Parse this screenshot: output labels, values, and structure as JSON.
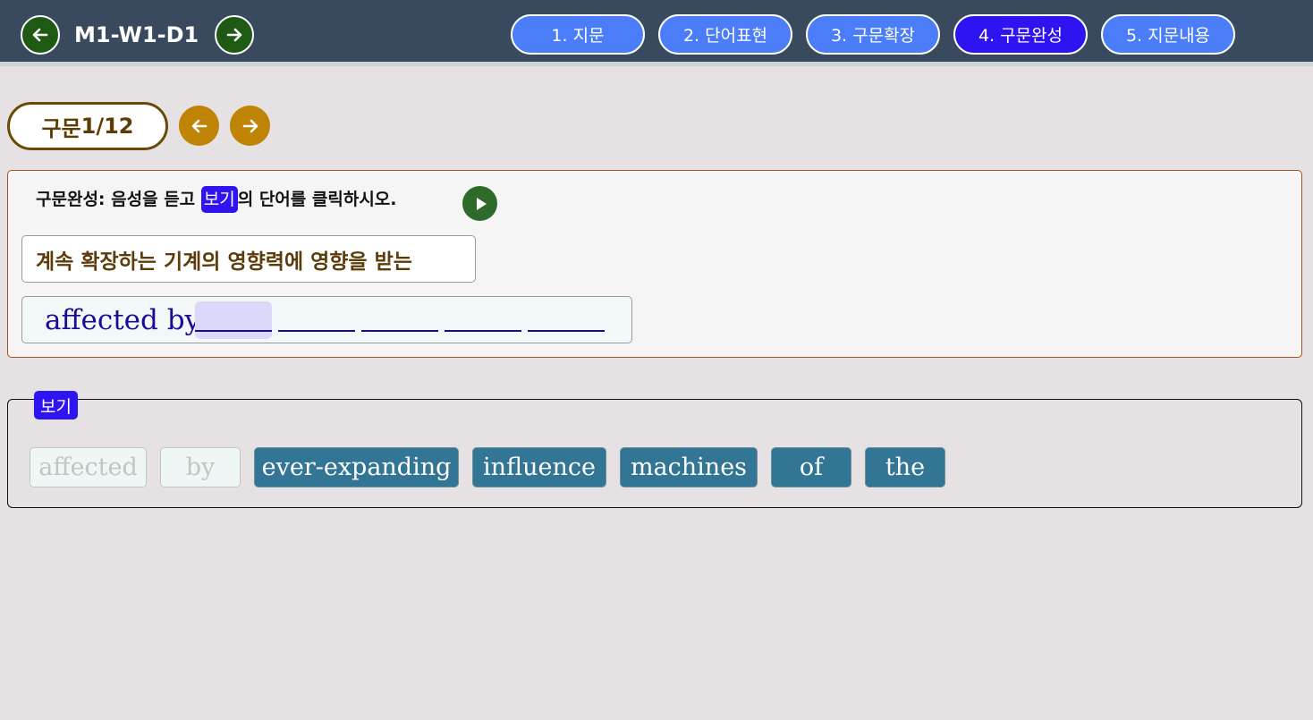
{
  "header": {
    "title": "M1-W1-D1",
    "tabs": [
      {
        "label": "1. 지문",
        "active": false
      },
      {
        "label": "2. 단어표현",
        "active": false
      },
      {
        "label": "3. 구문확장",
        "active": false
      },
      {
        "label": "4. 구문완성",
        "active": true
      },
      {
        "label": "5. 지문내용",
        "active": false
      }
    ]
  },
  "counter": {
    "prefix": "구문",
    "current": "1",
    "separator": "/",
    "total": "12"
  },
  "question": {
    "instruction_before": "구문완성: 음성을 듣고 ",
    "instruction_tag": "보기",
    "instruction_after": "의 단어를 클릭하시오.",
    "korean": "계속 확장하는 기계의 영향력에 영향을 받는",
    "answer_filled": "affected by",
    "blank_count": 5
  },
  "choices": {
    "legend": "보기",
    "words": [
      {
        "text": "affected",
        "used": true
      },
      {
        "text": "by",
        "used": true
      },
      {
        "text": "ever-expanding",
        "used": false
      },
      {
        "text": "influence",
        "used": false
      },
      {
        "text": "machines",
        "used": false
      },
      {
        "text": "of",
        "used": false
      },
      {
        "text": "the",
        "used": false
      }
    ]
  },
  "colors": {
    "header_bg": "#3a4a5e",
    "tab": "#4a7df7",
    "tab_active": "#2d14f0",
    "nav_green": "#1e5a14",
    "gold": "#bf8406",
    "chip": "#337594",
    "answer_text": "#1d0a96"
  }
}
